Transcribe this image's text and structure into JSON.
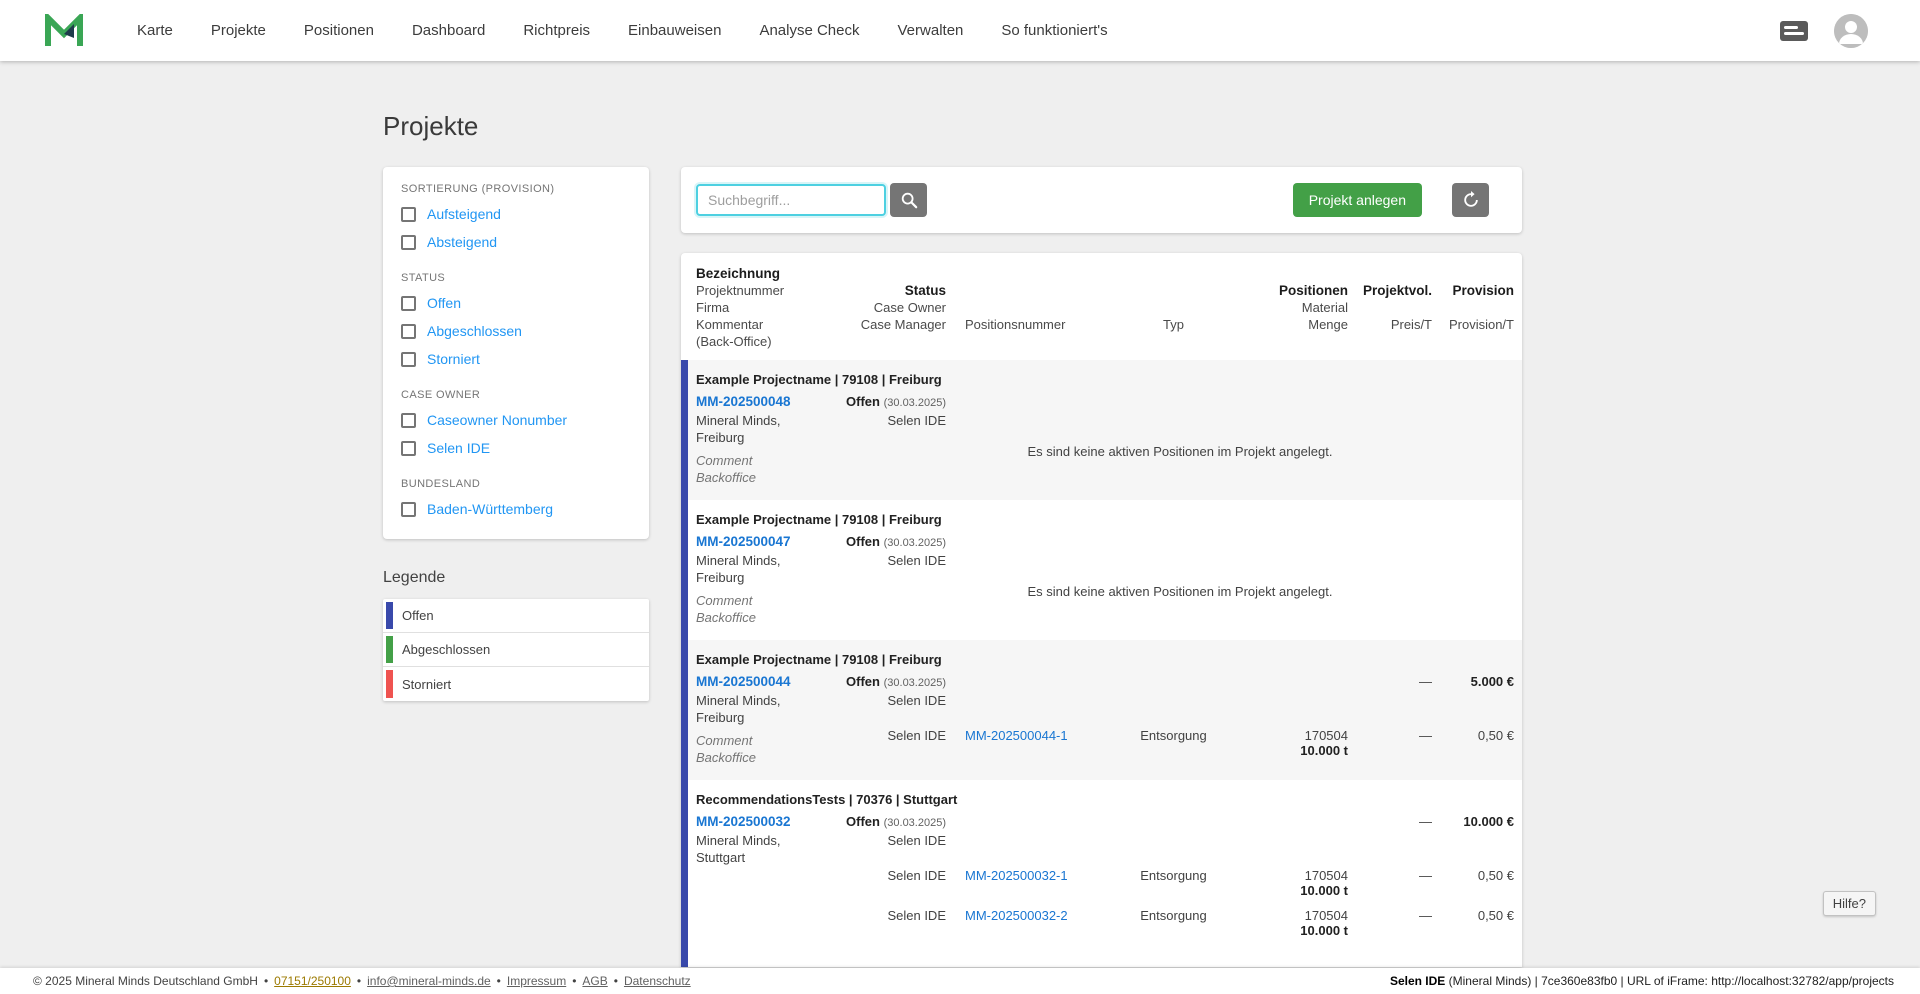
{
  "navbar": {
    "items": [
      "Karte",
      "Projekte",
      "Positionen",
      "Dashboard",
      "Richtpreis",
      "Einbauweisen",
      "Analyse Check",
      "Verwalten",
      "So funktioniert's"
    ]
  },
  "page_title": "Projekte",
  "filters": {
    "sort_label": "SORTIERUNG (PROVISION)",
    "sort_options": [
      "Aufsteigend",
      "Absteigend"
    ],
    "status_label": "STATUS",
    "status_options": [
      "Offen",
      "Abgeschlossen",
      "Storniert"
    ],
    "case_owner_label": "CASE OWNER",
    "case_owner_options": [
      "Caseowner Nonumber",
      "Selen IDE"
    ],
    "bundesland_label": "BUNDESLAND",
    "bundesland_options": [
      "Baden-Württemberg"
    ]
  },
  "legend": {
    "title": "Legende",
    "items": [
      {
        "label": "Offen",
        "color": "#3949ab"
      },
      {
        "label": "Abgeschlossen",
        "color": "#43a047"
      },
      {
        "label": "Storniert",
        "color": "#ef5350"
      }
    ]
  },
  "toolbar": {
    "search_placeholder": "Suchbegriff...",
    "create_label": "Projekt anlegen"
  },
  "table": {
    "header": {
      "bezeichnung": "Bezeichnung",
      "projektnummer": "Projektnummer",
      "firma": "Firma",
      "kommentar": "Kommentar",
      "backoffice": "(Back-Office)",
      "status": "Status",
      "case_owner": "Case Owner",
      "case_manager": "Case Manager",
      "positionsnummer": "Positionsnummer",
      "typ": "Typ",
      "positionen": "Positionen",
      "material": "Material",
      "menge": "Menge",
      "projektvol": "Projektvol.",
      "preis_t": "Preis/T",
      "provision": "Provision",
      "provision_t": "Provision/T"
    },
    "empty_message": "Es sind keine aktiven Positionen im Projekt angelegt.",
    "groups": [
      {
        "title": "Example Projectname | 79108 | Freiburg",
        "number": "MM-202500048",
        "company_line1": "Mineral Minds,",
        "company_line2": "Freiburg",
        "comment_line1": "Comment",
        "comment_line2": "Backoffice",
        "status": "Offen",
        "status_date": "(30.03.2025)",
        "case_owner": "Selen IDE"
      },
      {
        "title": "Example Projectname | 79108 | Freiburg",
        "number": "MM-202500047",
        "company_line1": "Mineral Minds,",
        "company_line2": "Freiburg",
        "comment_line1": "Comment",
        "comment_line2": "Backoffice",
        "status": "Offen",
        "status_date": "(30.03.2025)",
        "case_owner": "Selen IDE"
      },
      {
        "title": "Example Projectname | 79108 | Freiburg",
        "number": "MM-202500044",
        "company_line1": "Mineral Minds,",
        "company_line2": "Freiburg",
        "comment_line1": "Comment",
        "comment_line2": "Backoffice",
        "status": "Offen",
        "status_date": "(30.03.2025)",
        "case_owner": "Selen IDE",
        "preis": "—",
        "provision": "5.000 €",
        "positions": [
          {
            "case_manager": "Selen IDE",
            "number": "MM-202500044-1",
            "typ": "Entsorgung",
            "material": "170504",
            "menge": "10.000 t",
            "preis": "—",
            "provision": "0,50 €"
          }
        ]
      },
      {
        "title": "RecommendationsTests | 70376 | Stuttgart",
        "number": "MM-202500032",
        "company_line1": "Mineral Minds,",
        "company_line2": "Stuttgart",
        "status": "Offen",
        "status_date": "(30.03.2025)",
        "case_owner": "Selen IDE",
        "preis": "—",
        "provision": "10.000 €",
        "positions": [
          {
            "case_manager": "Selen IDE",
            "number": "MM-202500032-1",
            "typ": "Entsorgung",
            "material": "170504",
            "menge": "10.000 t",
            "preis": "—",
            "provision": "0,50 €"
          },
          {
            "case_manager": "Selen IDE",
            "number": "MM-202500032-2",
            "typ": "Entsorgung",
            "material": "170504",
            "menge": "10.000 t",
            "preis": "—",
            "provision": "0,50 €"
          }
        ]
      }
    ]
  },
  "help_label": "Hilfe?",
  "footer": {
    "copyright": "© 2025 Mineral Minds Deutschland GmbH",
    "sep": "•",
    "phone": "07151/250100",
    "email": "info@mineral-minds.de",
    "impressum": "Impressum",
    "agb": "AGB",
    "datenschutz": "Datenschutz",
    "session_user": "Selen IDE",
    "session_rest": " (Mineral Minds) | 7ce360e83fb0 | URL of iFrame: http://localhost:32782/app/projects"
  },
  "icons": {
    "logo": "mineral-minds-m-mark",
    "search": "magnifier",
    "refresh": "circular-arrows",
    "device": "server-card",
    "avatar": "person",
    "checkbox": "unchecked-square"
  },
  "colors": {
    "accent_link_blue": "#2196f3",
    "project_link_blue": "#1976d2",
    "status_open_bar": "#3949ab",
    "status_done": "#43a047",
    "status_cancelled": "#ef5350",
    "primary_button_green": "#43a047",
    "gray_button": "#757575"
  }
}
